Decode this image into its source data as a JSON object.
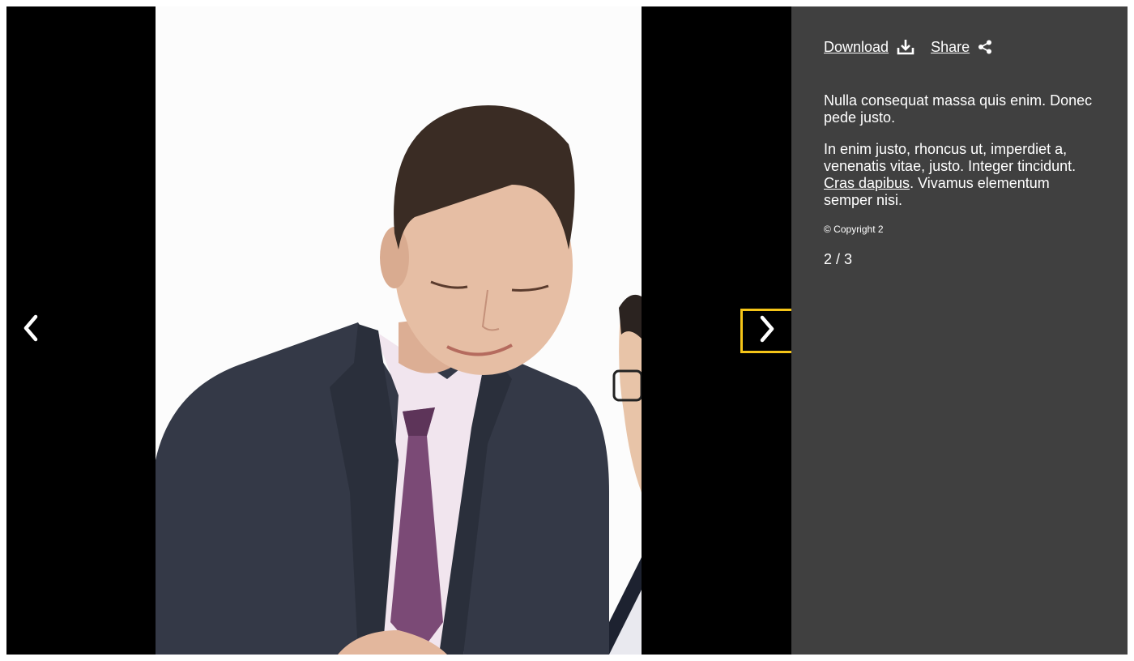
{
  "actions": {
    "download_label": "Download",
    "share_label": "Share"
  },
  "caption": {
    "paragraph1": "Nulla consequat massa quis enim. Donec pede justo.",
    "paragraph2_before": "In enim justo, rhoncus ut, imperdiet a, venenatis vitae, justo. Integer tincidunt. ",
    "paragraph2_link": "Cras dapibus",
    "paragraph2_after": ". Vivamus elementum semper nisi.",
    "copyright": "© Copyright 2"
  },
  "counter": "2 / 3",
  "icons": {
    "prev": "chevron-left-icon",
    "next": "chevron-right-icon",
    "download": "download-icon",
    "share": "share-icon"
  },
  "colors": {
    "stage_bg": "#000000",
    "sidebar_bg": "#404040",
    "focus_outline": "#f5c518"
  }
}
